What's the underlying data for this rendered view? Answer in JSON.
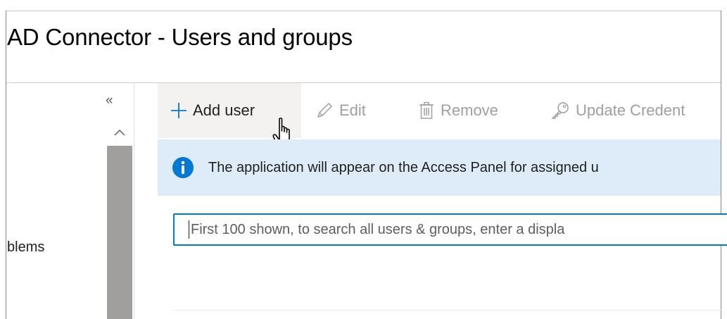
{
  "header": {
    "title": "AD Connector - Users and groups"
  },
  "sidebar": {
    "collapse_glyph": "«",
    "items": [
      {
        "label": "blems"
      }
    ]
  },
  "toolbar": {
    "add_user_label": "Add user",
    "edit_label": "Edit",
    "remove_label": "Remove",
    "update_credentials_label": "Update Credent"
  },
  "info_bar": {
    "text": "The application will appear on the Access Panel for assigned u",
    "icon": "info-icon"
  },
  "search": {
    "placeholder": "First 100 shown, to search all users & groups, enter a displa",
    "value": ""
  },
  "colors": {
    "accent": "#0078d4",
    "info_background": "#deecf9",
    "disabled_text": "#a19f9d",
    "hover_background": "#f3f2f1",
    "scrollbar": "#a19f9d"
  },
  "icons": [
    "plus-icon",
    "pencil-icon",
    "trash-icon",
    "key-icon",
    "info-icon",
    "hand-cursor-icon",
    "chevron-up-icon",
    "double-chevron-left-icon"
  ]
}
